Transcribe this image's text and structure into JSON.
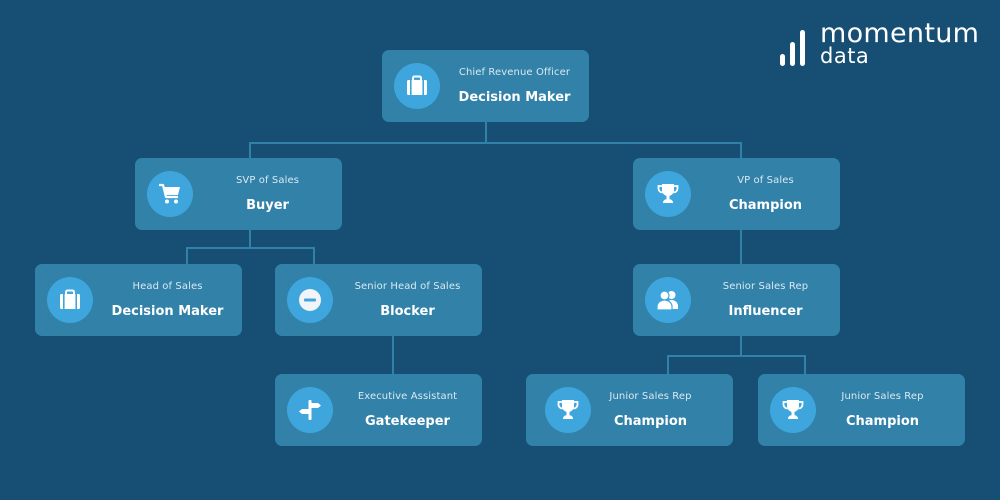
{
  "logo": {
    "line1": "momentum",
    "line2": "data",
    "icon": "bar-chart-icon"
  },
  "colors": {
    "background": "#174e74",
    "card": "#3181a8",
    "icon_circle": "#3ea6dc",
    "connector": "#3181a8",
    "text": "#ffffff"
  },
  "nodes": [
    {
      "id": "cro",
      "title": "Chief Revenue Officer",
      "role": "Decision Maker",
      "icon": "briefcase-icon",
      "parent": null
    },
    {
      "id": "svp",
      "title": "SVP of Sales",
      "role": "Buyer",
      "icon": "shopping-cart-icon",
      "parent": "cro"
    },
    {
      "id": "vp",
      "title": "VP of Sales",
      "role": "Champion",
      "icon": "trophy-icon",
      "parent": "cro"
    },
    {
      "id": "head",
      "title": "Head of Sales",
      "role": "Decision Maker",
      "icon": "briefcase-icon",
      "parent": "svp"
    },
    {
      "id": "senior-head",
      "title": "Senior Head of Sales",
      "role": "Blocker",
      "icon": "minus-circle-icon",
      "parent": "svp"
    },
    {
      "id": "senior-rep",
      "title": "Senior Sales Rep",
      "role": "Influencer",
      "icon": "users-icon",
      "parent": "vp"
    },
    {
      "id": "exec-assistant",
      "title": "Executive Assistant",
      "role": "Gatekeeper",
      "icon": "signpost-icon",
      "parent": "senior-head"
    },
    {
      "id": "junior-rep-1",
      "title": "Junior Sales Rep",
      "role": "Champion",
      "icon": "trophy-icon",
      "parent": "senior-rep"
    },
    {
      "id": "junior-rep-2",
      "title": "Junior Sales Rep",
      "role": "Champion",
      "icon": "trophy-icon",
      "parent": "senior-rep"
    }
  ]
}
